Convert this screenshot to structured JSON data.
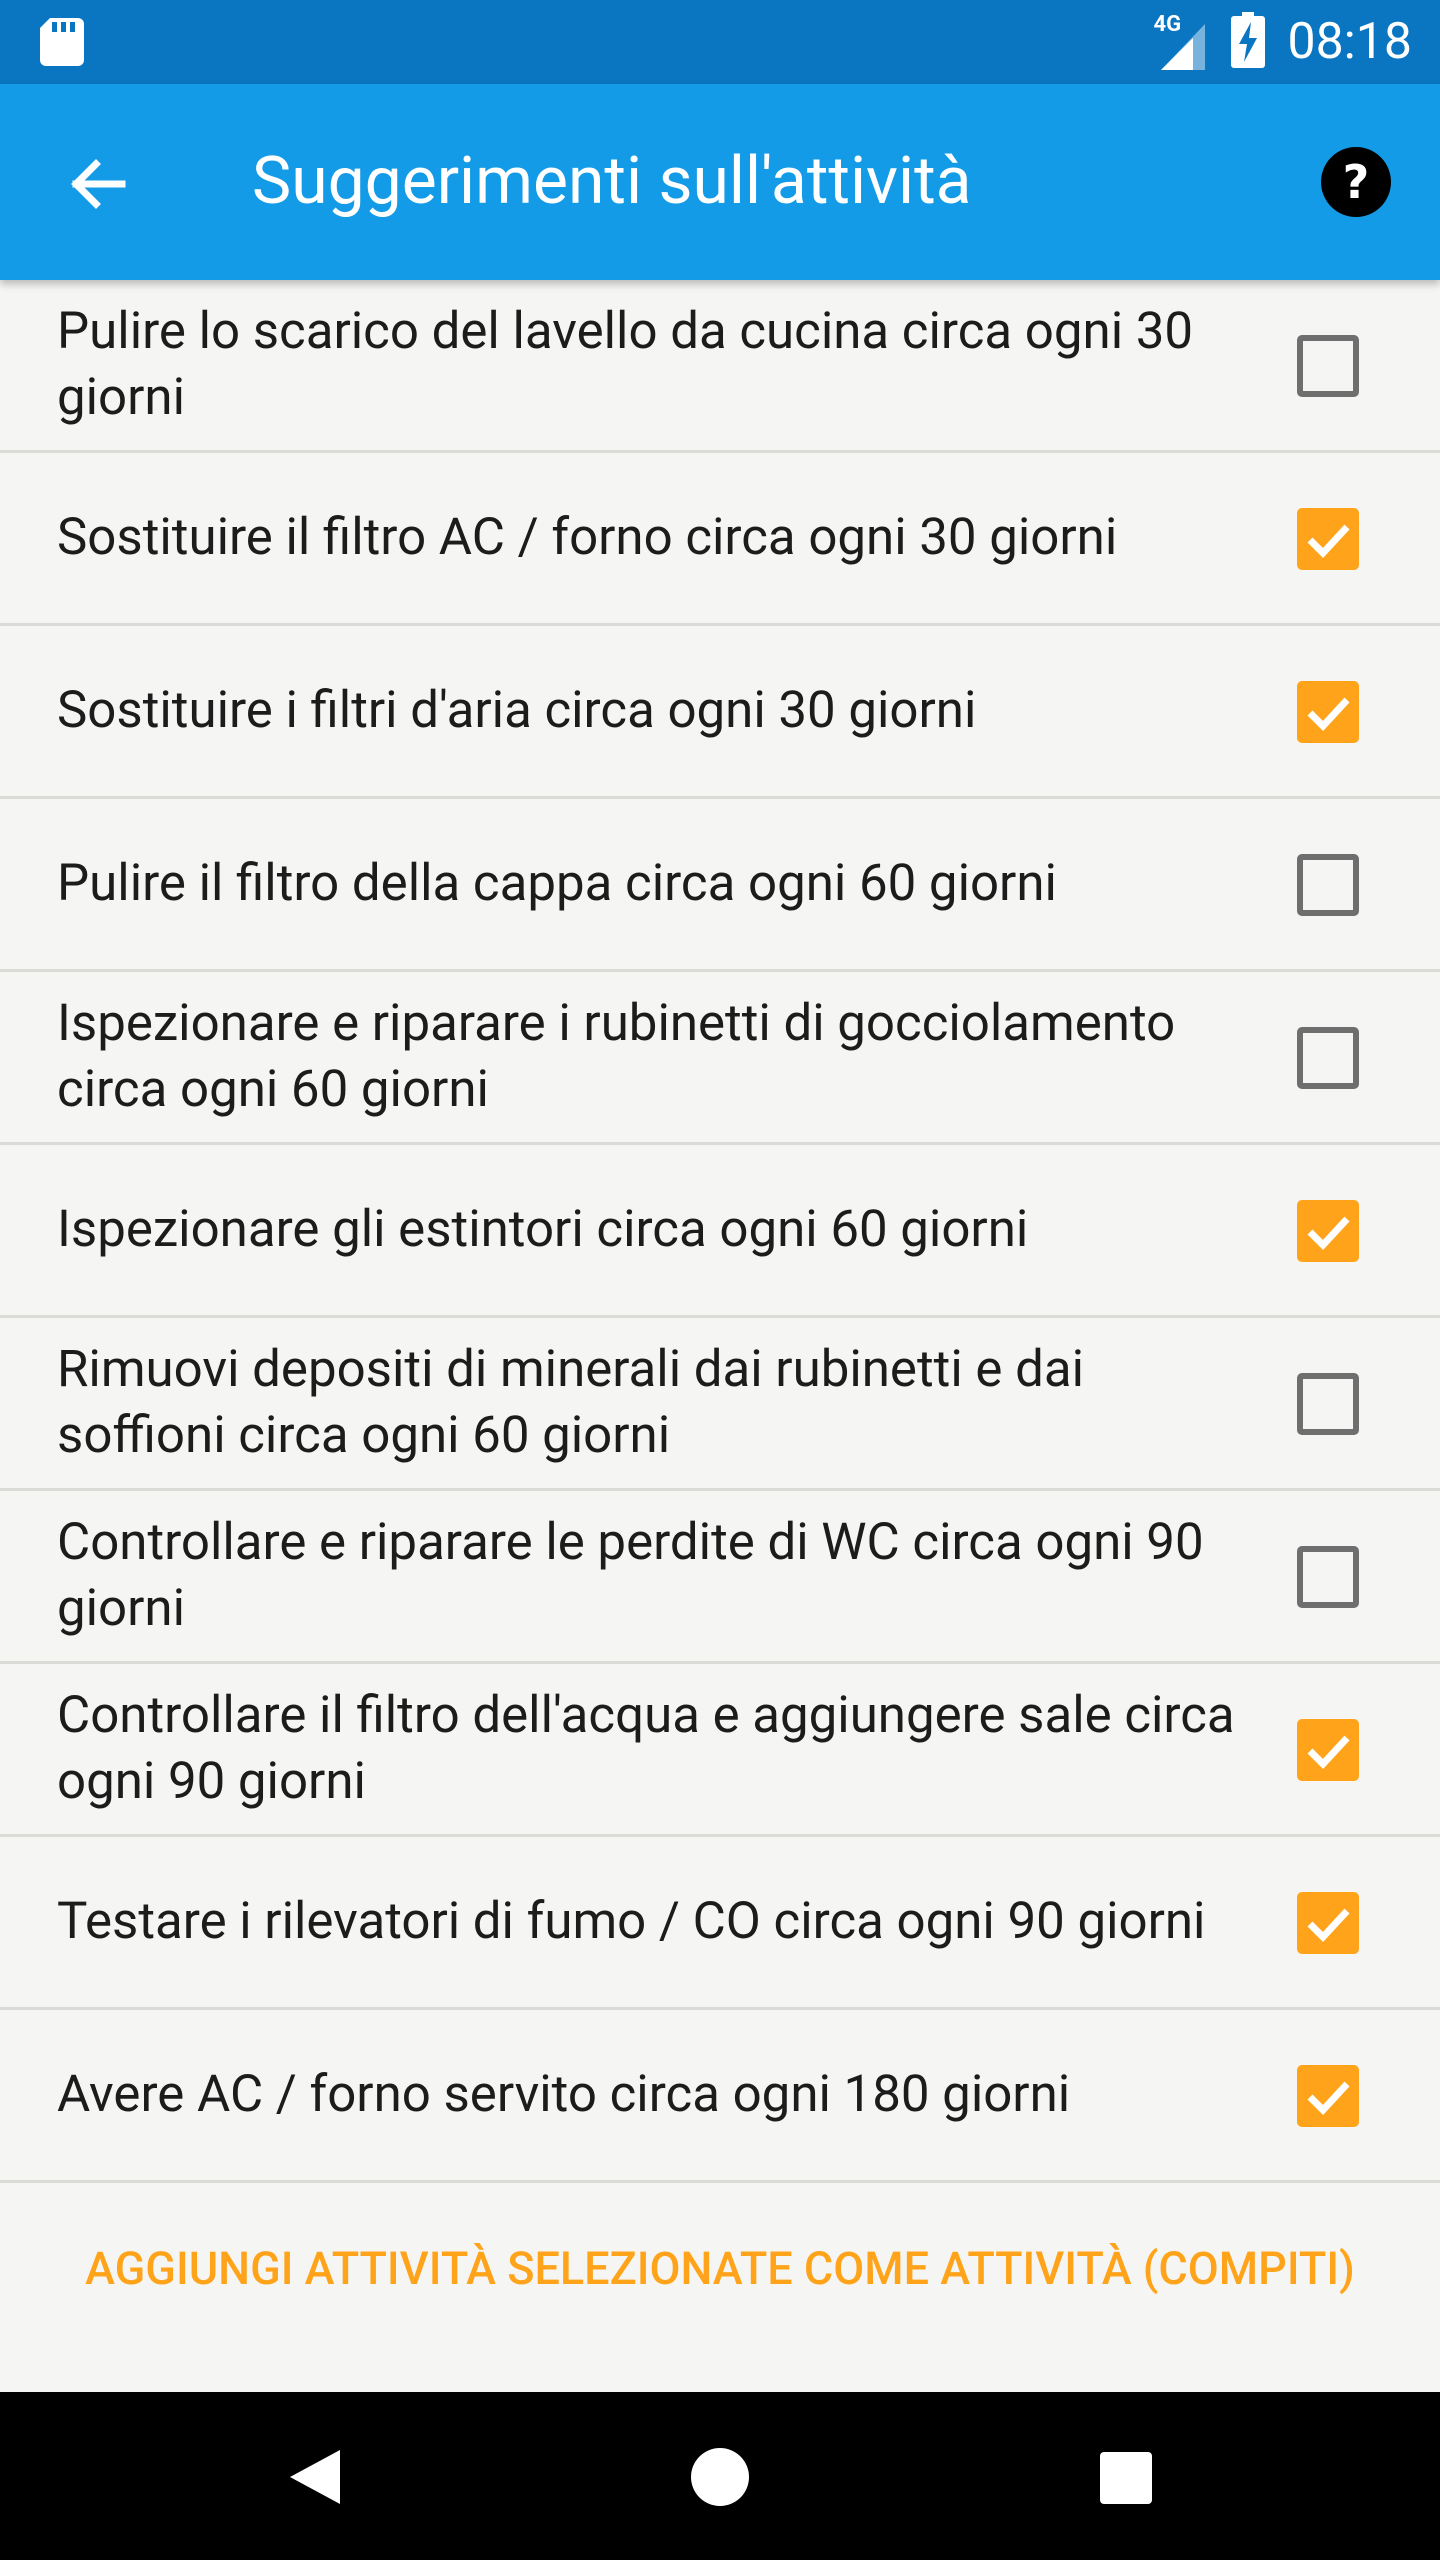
{
  "status_bar": {
    "time": "08:18",
    "network": "4G",
    "icons": [
      "sd-card-icon",
      "signal-icon",
      "battery-charging-icon"
    ]
  },
  "app_bar": {
    "title": "Suggerimenti sull'attività",
    "back_icon": "arrow-back-icon",
    "help_icon": "help-circle-icon"
  },
  "tasks": [
    {
      "label": "Pulire lo scarico del lavello da cucina circa ogni 30 giorni",
      "checked": false
    },
    {
      "label": "Sostituire il filtro AC / forno circa ogni 30 giorni",
      "checked": true
    },
    {
      "label": "Sostituire i filtri d'aria circa ogni 30 giorni",
      "checked": true
    },
    {
      "label": "Pulire il filtro della cappa circa ogni 60 giorni",
      "checked": false
    },
    {
      "label": "Ispezionare e riparare i rubinetti di gocciolamento circa ogni 60 giorni",
      "checked": false
    },
    {
      "label": "Ispezionare gli estintori circa ogni 60 giorni",
      "checked": true
    },
    {
      "label": "Rimuovi depositi di minerali dai rubinetti e dai soffioni circa ogni 60 giorni",
      "checked": false
    },
    {
      "label": "Controllare e riparare le perdite di WC circa ogni 90 giorni",
      "checked": false
    },
    {
      "label": "Controllare il filtro dell'acqua e aggiungere sale circa ogni 90 giorni",
      "checked": true
    },
    {
      "label": "Testare i rilevatori di fumo / CO circa ogni 90 giorni",
      "checked": true
    },
    {
      "label": "Avere AC / forno servito circa ogni 180 giorni",
      "checked": true
    }
  ],
  "action": {
    "label": "AGGIUNGI ATTIVITÀ SELEZIONATE COME ATTIVITÀ (COMPITI)"
  },
  "nav_bar": {
    "icons": [
      "back-triangle-icon",
      "home-circle-icon",
      "recents-square-icon"
    ]
  },
  "colors": {
    "status_bar": "#0a76c2",
    "app_bar": "#149be7",
    "accent": "#ffa31a",
    "background": "#f5f6f3"
  }
}
